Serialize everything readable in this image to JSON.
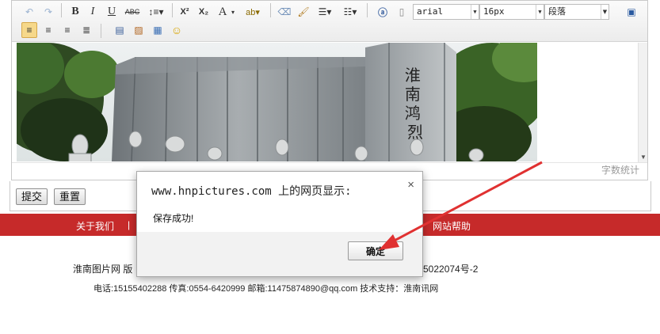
{
  "editor": {
    "font_family": "arial",
    "font_size": "16px",
    "paragraph": "段落",
    "word_count": "字数统计"
  },
  "toolbar": {
    "bold": "B",
    "italic": "I",
    "underline": "U",
    "strikethrough": "ABC",
    "superscript": "X²",
    "subscript": "X₂",
    "font_color": "A"
  },
  "image": {
    "stele_text": "淮南鸿烈"
  },
  "form": {
    "submit": "提交",
    "reset": "重置"
  },
  "footer": {
    "nav_about": "关于我们",
    "nav_divider": "|",
    "nav_help": "网站帮助",
    "line1_left": "淮南图片网 版",
    "line1_right": "5022074号-2",
    "line2": "电话:15155402288 传真:0554-6420999 邮箱:11475874890@qq.com 技术支持：淮南讯网"
  },
  "dialog": {
    "title": "www.hnpictures.com 上的网页显示:",
    "message": "保存成功!",
    "ok": "确定",
    "close": "×"
  },
  "colors": {
    "navbar": "#c62a2a",
    "arrow": "#e03131"
  }
}
